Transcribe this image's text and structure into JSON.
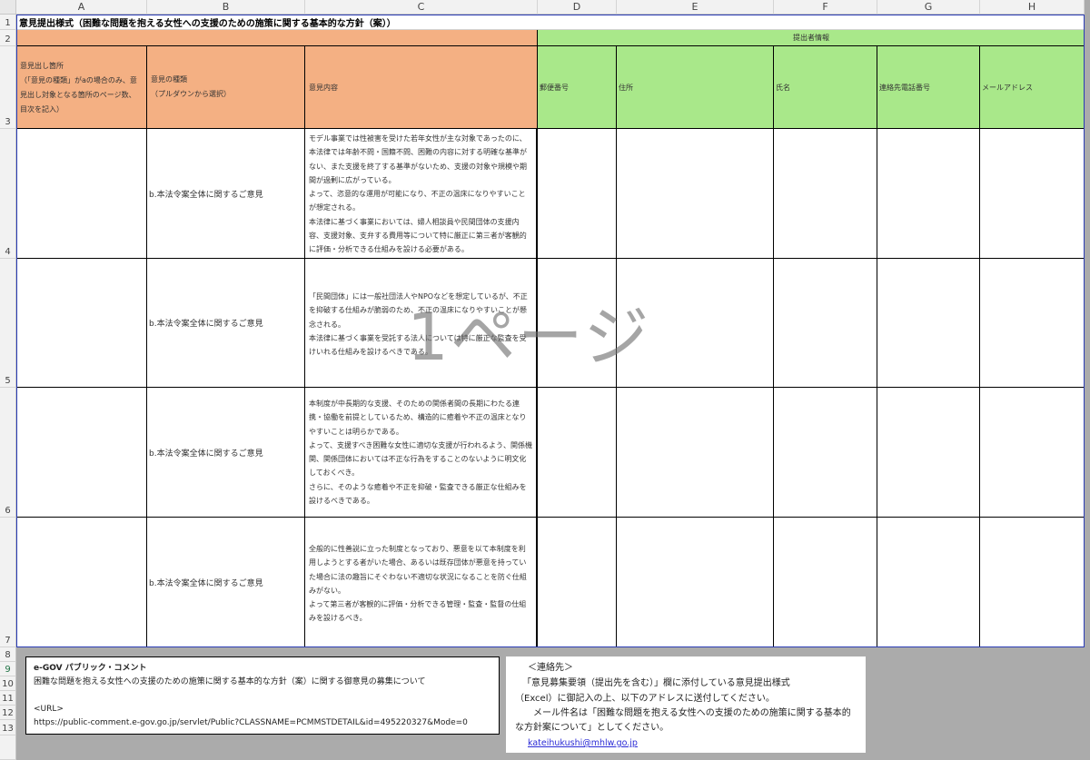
{
  "spreadsheet": {
    "columns": [
      "A",
      "B",
      "C",
      "D",
      "E",
      "F",
      "G",
      "H"
    ],
    "rows": [
      "1",
      "2",
      "3",
      "4",
      "5",
      "6",
      "7",
      "8",
      "9",
      "10",
      "11",
      "12",
      "13"
    ],
    "title": "意見提出様式（困難な問題を抱える女性への支援のための施策に関する基本的な方針（案））",
    "submitter_group_label": "提出者情報",
    "headers": {
      "location": "意見出し箇所\n（「意見の種類」がaの場合のみ、意見出し対象となる箇所のページ数、目次を記入）",
      "type": "意見の種類\n（プルダウンから選択）",
      "content": "意見内容",
      "postal": "郵便番号",
      "address": "住所",
      "name": "氏名",
      "phone": "連絡先電話番号",
      "email": "メールアドレス"
    },
    "entries": [
      {
        "type": "b.本法令案全体に関するご意見",
        "content": "モデル事業では性被害を受けた若年女性が主な対象であったのに、本法律では年齢不問・国籍不問、困難の内容に対する明確な基準がない、また支援を終了する基準がないため、支援の対象や規模や期間が過剰に広がっている。\nよって、恣意的な運用が可能になり、不正の温床になりやすいことが想定される。\n本法律に基づく事業においては、婦人相談員や民間団体の支援内容、支援対象、支弁する費用等について特に厳正に第三者が客観的に評価・分析できる仕組みを設ける必要がある。"
      },
      {
        "type": "b.本法令案全体に関するご意見",
        "content": "「民間団体」には一般社団法人やNPOなどを想定しているが、不正を抑破する仕組みが脆弱のため、不正の温床になりやすいことが懸念される。\n本法律に基づく事業を受託する法人については特に厳正な監査を受けいれる仕組みを設けるべきである。"
      },
      {
        "type": "b.本法令案全体に関するご意見",
        "content": "本制度が中長期的な支援、そのための関係者間の長期にわたる連携・協働を前提としているため、構造的に癒着や不正の温床となりやすいことは明らかである。\nよって、支援すべき困難な女性に適切な支援が行われるよう、関係機関、関係団体においては不正な行為をすることのないように明文化しておくべき。\nさらに、そのような癒着や不正を抑破・監査できる厳正な仕組みを設けるべきである。"
      },
      {
        "type": "b.本法令案全体に関するご意見",
        "content": "全般的に性善説に立った制度となっており、悪意を以て本制度を利用しようとする者がいた場合、あるいは既存団体が悪意を持っていた場合に法の趣旨にそぐわない不適切な状況になることを防ぐ仕組みがない。\nよって第三者が客観的に評価・分析できる管理・監査・監督の仕組みを設けるべき。"
      }
    ],
    "watermark": "1ページ"
  },
  "egov": {
    "heading": "e-GOV パブリック・コメント",
    "desc": "困難な問題を抱える女性への支援のための施策に関する基本的な方針（案）に関する御意見の募集について",
    "url_label": "<URL>",
    "url": "https://public-comment.e-gov.go.jp/servlet/Public?CLASSNAME=PCMMSTDETAIL&id=495220327&Mode=0"
  },
  "contact": {
    "heading": "＜連絡先＞",
    "line1": "「意見募集要領（提出先を含む）」欄に添付している意見提出様式",
    "line2": "（Excel）に御記入の上、以下のアドレスに送付してください。",
    "line3": "メール件名は「困難な問題を抱える女性への支援のための施策に関する基本的な方針案について」としてください。",
    "email": "kateihukushi@mhlw.go.jp"
  }
}
